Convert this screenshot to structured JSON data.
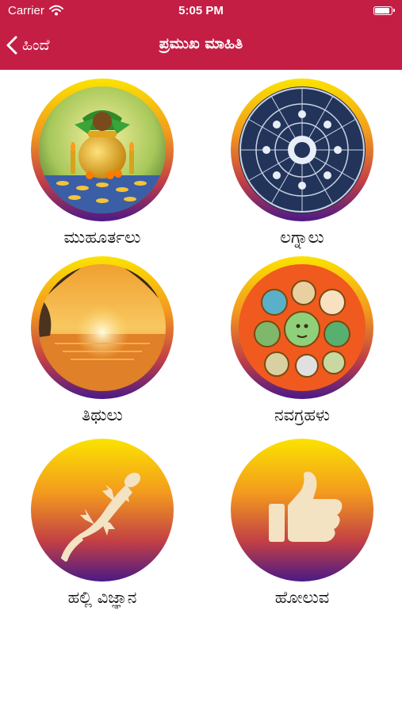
{
  "status_bar": {
    "carrier": "Carrier",
    "time": "5:05 PM"
  },
  "nav": {
    "back_label": "ಹಿಂದೆ",
    "title": "ಪ್ರಮುಖ ಮಾಹಿತಿ"
  },
  "grid": {
    "items": [
      {
        "label": "ಮುಹೂರ್ತಲು"
      },
      {
        "label": "ಲಗ್ನಾಲು"
      },
      {
        "label": "ತಿಥುಲು"
      },
      {
        "label": "ನವಗ್ರಹಳು"
      },
      {
        "label": "ಹಲ್ಲಿ ವಿಜ್ಞಾನ"
      },
      {
        "label": "ಹೋಲುವ"
      }
    ]
  },
  "colors": {
    "header": "#c41e45",
    "ring_top": "#fbe300",
    "ring_bottom": "#4a1a86"
  }
}
